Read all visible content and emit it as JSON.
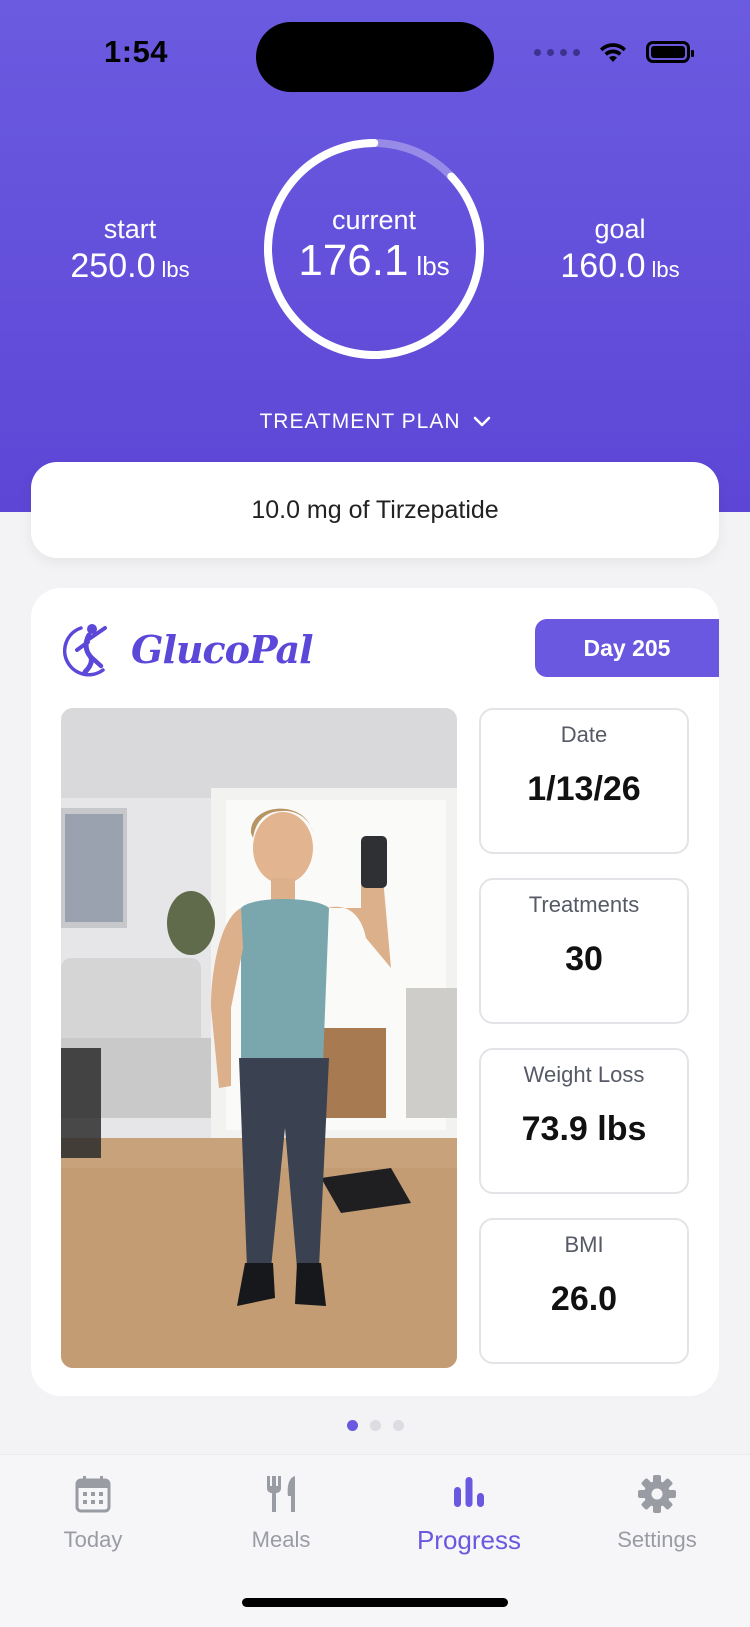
{
  "status": {
    "time": "1:54"
  },
  "weights": {
    "start": {
      "label": "start",
      "value": "250.0",
      "unit": "lbs"
    },
    "current": {
      "label": "current",
      "value": "176.1",
      "unit": "lbs"
    },
    "goal": {
      "label": "goal",
      "value": "160.0",
      "unit": "lbs"
    },
    "progress_fraction": 0.87
  },
  "treatment_plan": {
    "label": "TREATMENT PLAN",
    "dose": "10.0 mg of Tirzepatide"
  },
  "card": {
    "brand": "GlucoPal",
    "day_badge": "Day 205",
    "metrics": [
      {
        "label": "Date",
        "value": "1/13/26"
      },
      {
        "label": "Treatments",
        "value": "30"
      },
      {
        "label": "Weight Loss",
        "value": "73.9 lbs"
      },
      {
        "label": "BMI",
        "value": "26.0"
      }
    ]
  },
  "pager": {
    "count": 3,
    "active": 0
  },
  "tabs": [
    {
      "label": "Today",
      "icon": "calendar-icon",
      "active": false
    },
    {
      "label": "Meals",
      "icon": "fork-knife-icon",
      "active": false
    },
    {
      "label": "Progress",
      "icon": "bar-chart-icon",
      "active": true
    },
    {
      "label": "Settings",
      "icon": "gear-icon",
      "active": false
    }
  ],
  "colors": {
    "accent": "#6a58e0",
    "hero_top": "#6b5be0",
    "hero_bottom": "#5d46d6"
  }
}
